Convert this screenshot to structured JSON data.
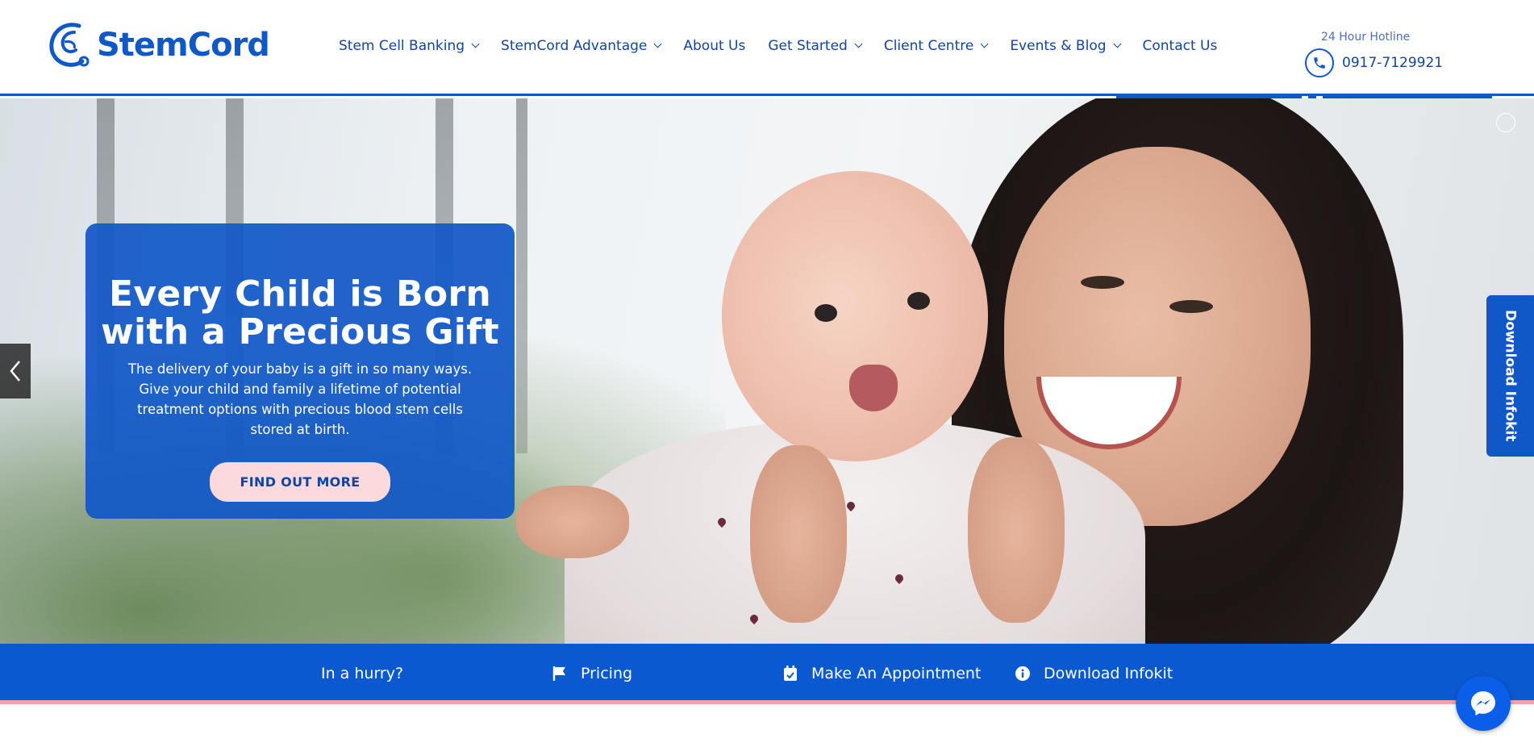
{
  "brand": {
    "name": "StemCord",
    "primary_color": "#1158c7",
    "accent_pink": "#f4a0a9"
  },
  "nav": {
    "items": [
      {
        "label": "Stem Cell Banking",
        "dropdown": true
      },
      {
        "label": "StemCord Advantage",
        "dropdown": true
      },
      {
        "label": "About Us",
        "dropdown": false
      },
      {
        "label": "Get Started",
        "dropdown": true
      },
      {
        "label": "Client Centre",
        "dropdown": true
      },
      {
        "label": "Events & Blog",
        "dropdown": true
      },
      {
        "label": "Contact Us",
        "dropdown": false
      }
    ]
  },
  "hotline": {
    "label": "24 Hour Hotline",
    "number": "0917-7129921",
    "icon": "phone-icon"
  },
  "hero": {
    "title_line1": "Every Child is Born",
    "title_line2": "with a Precious Gift",
    "text": "The delivery of your baby is a gift in so many ways. Give your child and family a lifetime of potential treatment options with precious blood stem cells stored at birth.",
    "button": "FIND OUT MORE",
    "prev_icon": "chevron-left-icon"
  },
  "side_tab": {
    "label": "Download Infokit"
  },
  "quickbar": {
    "items": [
      {
        "label": "In a hurry?",
        "icon": ""
      },
      {
        "label": "Pricing",
        "icon": "flag-icon"
      },
      {
        "label": "Make An Appointment",
        "icon": "calendar-check-icon"
      },
      {
        "label": "Download Infokit",
        "icon": "info-icon"
      }
    ]
  },
  "messenger": {
    "icon": "messenger-icon"
  }
}
